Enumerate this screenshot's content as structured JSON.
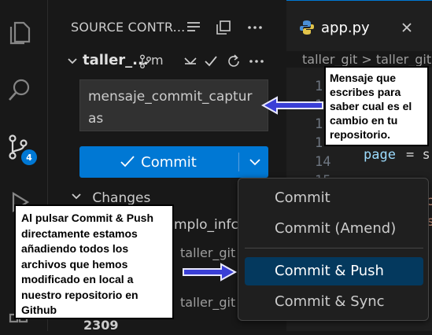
{
  "sidebar": {
    "title": "SOURCE CONTR...",
    "repo_name": "taller_...",
    "repo_branch": "m",
    "commit_message": "mensaje_commit_capturas",
    "commit_label": "Commit",
    "changes_label": "Changes",
    "bg_rows": [
      {
        "text": "mplo_infc."
      },
      {
        "text": "taller_git"
      },
      {
        "text": "taller_git ."
      },
      {
        "text": "2309"
      }
    ],
    "scm_badge": "4"
  },
  "editor": {
    "tab_label": "app.py",
    "breadcrumb": "taller_git > taller_git",
    "line_numbers": [
      "1",
      "1",
      "1",
      "1",
      "14",
      "15"
    ],
    "code_page": "page",
    "code_eq": "= s",
    "code_frag_a": "a",
    "code_frag_c": "c",
    "code_frag_s": "s"
  },
  "commit_menu": {
    "items": [
      {
        "label": "Commit"
      },
      {
        "label": "Commit (Amend)"
      },
      {
        "label": "Commit & Push"
      },
      {
        "label": "Commit & Sync"
      }
    ]
  },
  "annotations": {
    "note1": "Mensaje que escribes para saber cual es el cambio en tu repositorio.",
    "note2": "Al pulsar Commit & Push directamente estamos añadiendo todos los archivos que hemos modificado en local a nuestro repositorio en Github"
  },
  "colors": {
    "accent": "#0078d4",
    "arrow": "#3a3fd6",
    "menu_selected": "#04395e"
  }
}
